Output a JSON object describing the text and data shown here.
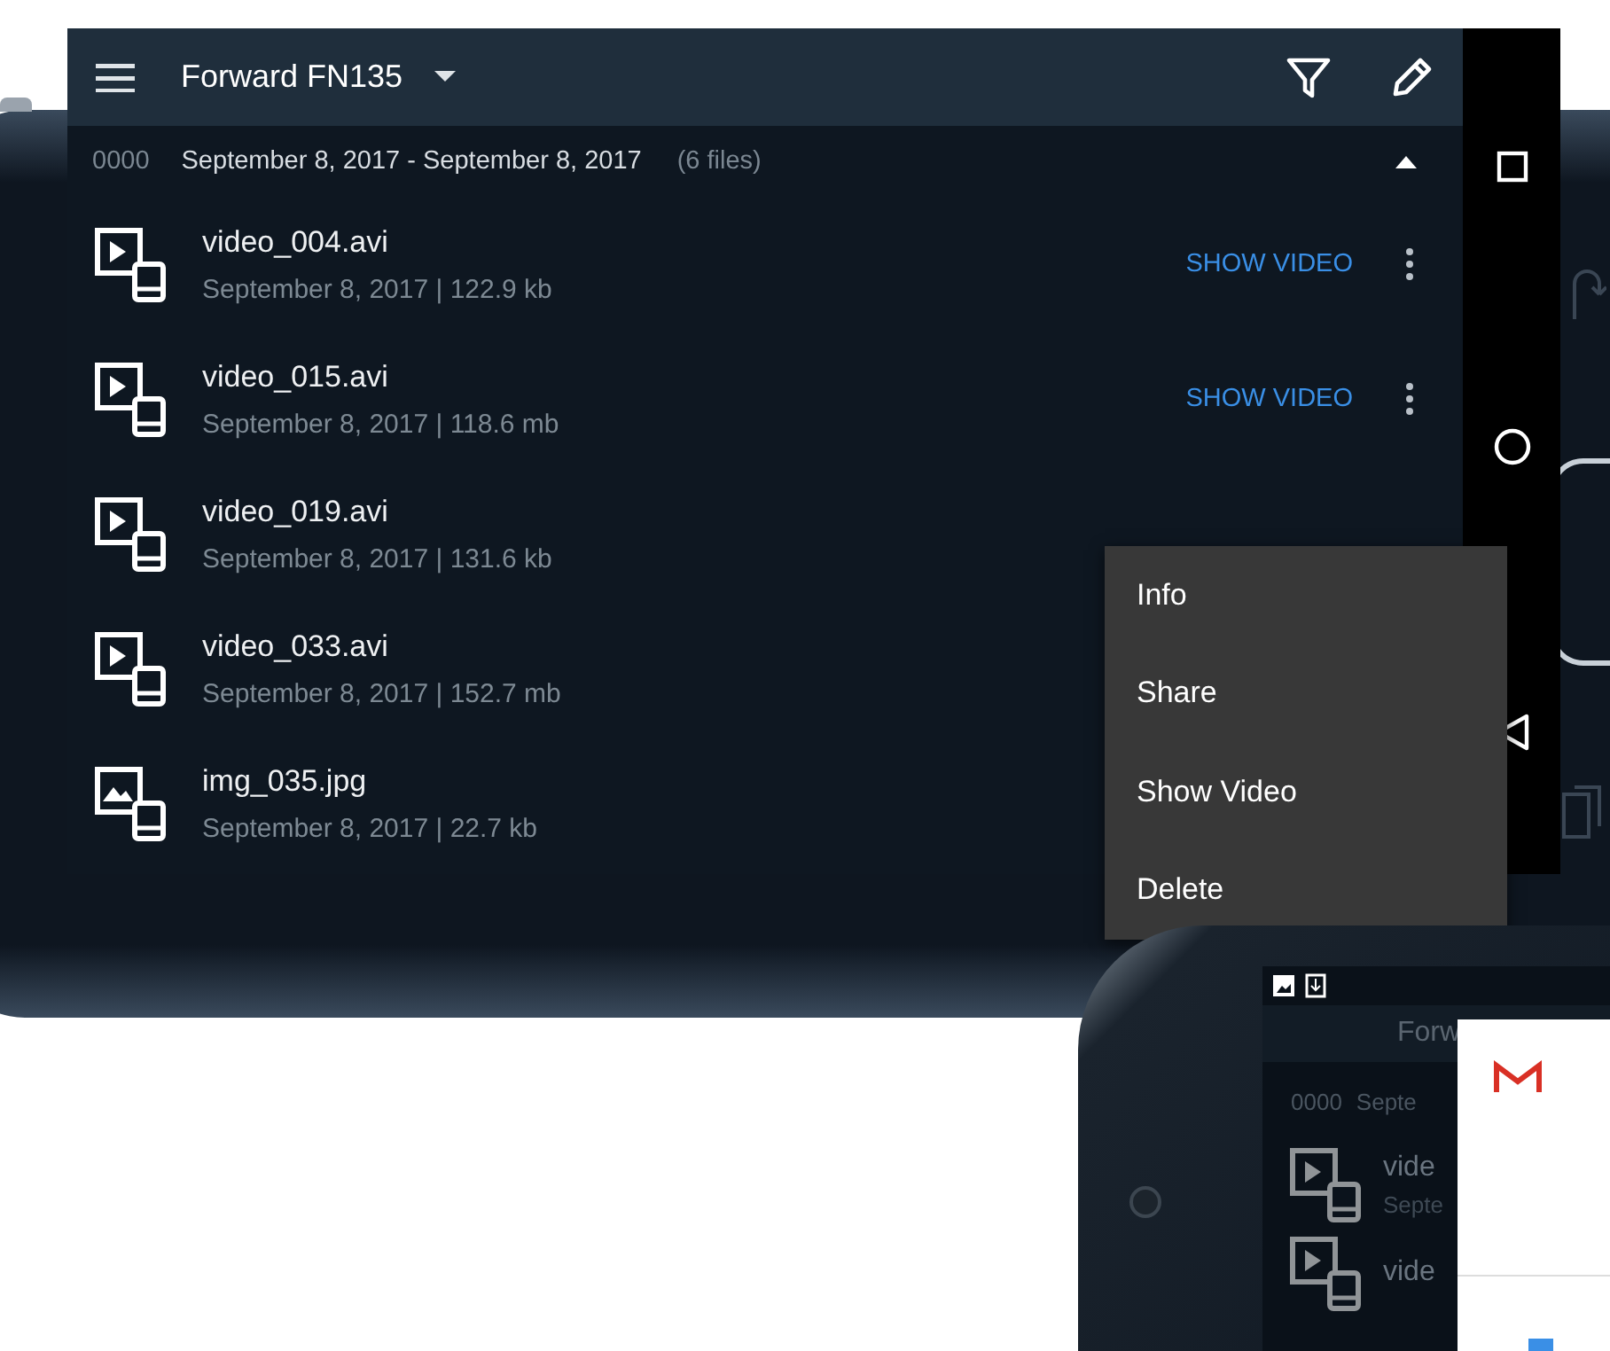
{
  "app_bar": {
    "title": "Forward FN135"
  },
  "group": {
    "code": "0000",
    "date_range": "September 8, 2017 - September 8, 2017",
    "count": "(6 files)",
    "expanded": true
  },
  "files": [
    {
      "name": "video_004.avi",
      "details": "September 8, 2017 | 122.9 kb",
      "kind": "video",
      "action": "SHOW VIDEO"
    },
    {
      "name": "video_015.avi",
      "details": "September 8, 2017 | 118.6 mb",
      "kind": "video",
      "action": "SHOW VIDEO"
    },
    {
      "name": "video_019.avi",
      "details": "September 8, 2017 | 131.6 kb",
      "kind": "video"
    },
    {
      "name": "video_033.avi",
      "details": "September 8, 2017 | 152.7 mb",
      "kind": "video"
    },
    {
      "name": "img_035.jpg",
      "details": "September 8, 2017 | 22.7 kb",
      "kind": "image"
    }
  ],
  "menu": {
    "items": [
      "Info",
      "Share",
      "Show Video",
      "Delete"
    ]
  },
  "second_phone": {
    "title": "Forw",
    "group_code": "0000",
    "group_date": "Septe",
    "files": [
      {
        "name": "vide",
        "details": "Septe",
        "kind": "video"
      },
      {
        "name": "vide",
        "kind": "video"
      }
    ]
  }
}
